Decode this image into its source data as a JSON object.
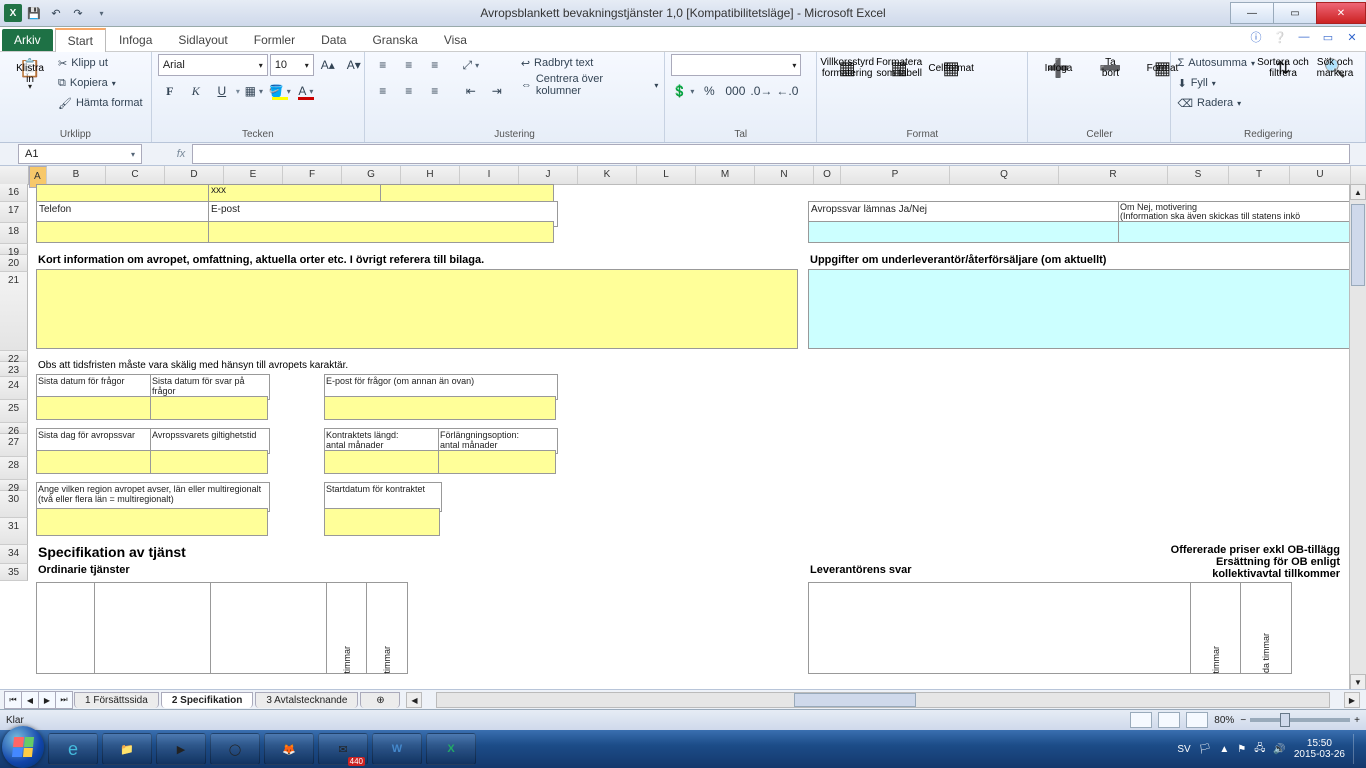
{
  "title": "Avropsblankett bevakningstjänster 1,0  [Kompatibilitetsläge] - Microsoft Excel",
  "tabs": {
    "file": "Arkiv",
    "home": "Start",
    "insert": "Infoga",
    "layout": "Sidlayout",
    "formulas": "Formler",
    "data": "Data",
    "review": "Granska",
    "view": "Visa"
  },
  "ribbon": {
    "clipboard": {
      "label": "Urklipp",
      "paste": "Klistra\nin",
      "cut": "Klipp ut",
      "copy": "Kopiera",
      "painter": "Hämta format"
    },
    "font": {
      "label": "Tecken",
      "name": "Arial",
      "size": "10"
    },
    "align": {
      "label": "Justering",
      "wrap": "Radbryt text",
      "merge": "Centrera över kolumner"
    },
    "number": {
      "label": "Tal"
    },
    "styles": {
      "label": "Format",
      "cond": "Villkorsstyrd\nformatering",
      "table": "Formatera\nsom tabell",
      "cell": "Cellformat"
    },
    "cells": {
      "label": "Celler",
      "insert": "Infoga",
      "delete": "Ta\nbort",
      "format": "Format"
    },
    "editing": {
      "label": "Redigering",
      "sum": "Autosumma",
      "fill": "Fyll",
      "clear": "Radera",
      "sort": "Sortera och\nfiltrera",
      "find": "Sök och\nmarkera"
    }
  },
  "namebox": "A1",
  "columns": [
    "A",
    "B",
    "C",
    "D",
    "E",
    "F",
    "G",
    "H",
    "I",
    "J",
    "K",
    "L",
    "M",
    "N",
    "O",
    "P",
    "Q",
    "R",
    "S",
    "T",
    "U"
  ],
  "rows": [
    "16",
    "17",
    "18",
    "19",
    "20",
    "21",
    "22",
    "23",
    "24",
    "25",
    "26",
    "27",
    "28",
    "29",
    "30",
    "31",
    "34",
    "35"
  ],
  "sheet": {
    "xxx": "xxx",
    "telefon": "Telefon",
    "epost": "E-post",
    "avropssvar": "Avropssvar lämnas Ja/Nej",
    "omnej1": "Om Nej, motivering",
    "omnej2": "(Information ska även skickas till statens inkö",
    "kortinfo": "Kort information om avropet, omfattning, aktuella orter etc. I övrigt referera till bilaga.",
    "uppgifter": "Uppgifter om underleverantör/återförsäljare (om aktuellt)",
    "obs": "Obs att tidsfristen måste vara skälig med hänsyn till avropets karaktär.",
    "sista_fragor": "Sista datum för frågor",
    "sista_svar": "Sista datum för svar på frågor",
    "epost_fragor": "E-post för frågor (om annan än ovan)",
    "sista_avrop": "Sista dag för avropssvar",
    "giltig": "Avropssvarets giltighetstid",
    "kontrakt": "Kontraktets längd:\nantal månader",
    "forlang": "Förlängningsoption:\nantal månader",
    "region": "Ange vilken region avropet avser, län eller multiregionalt (två eller flera län = multiregionalt)",
    "startdatum": "Startdatum för kontraktet",
    "spec": "Specifikation av tjänst",
    "ord": "Ordinarie tjänster",
    "lev": "Leverantörens svar",
    "off1": "Offererade priser exkl OB-tillägg",
    "off2": "Ersättning för OB enligt",
    "off3": "kollektivavtal tillkommer",
    "timmar": "timmar",
    "da_timmar": "da timmar"
  },
  "sheets": {
    "s1": "1 Försättssida",
    "s2": "2 Specifikation",
    "s3": "3 Avtalstecknande"
  },
  "status": {
    "ready": "Klar",
    "zoom": "80%",
    "lang": "SV",
    "time": "15:50",
    "date": "2015-03-26"
  },
  "tb_badge": "440"
}
